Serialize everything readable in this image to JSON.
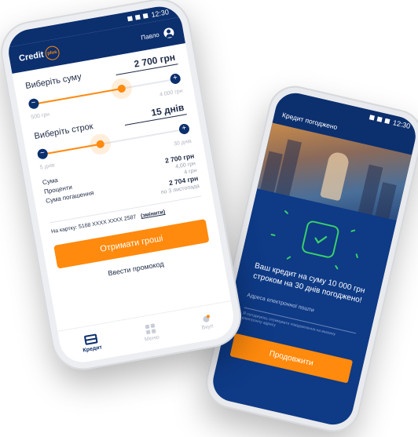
{
  "back_phone": {
    "status_time": "12:30",
    "header_title": "Кредит погоджено",
    "message": "Ваш кредит на суму 10 000 грн строком на 30 днів погоджено!",
    "email_label": "Адреса електронної пошти",
    "small_note": "Я погоджуюсь отримувати повідомлення на вказану електронну адресу",
    "continue_button": "Продовжити",
    "accent_color": "#ff8a0d",
    "bg_color": "#0e3a86",
    "success_color": "#3ad06a"
  },
  "front_phone": {
    "status_time": "12:30",
    "logo_text": "Credit",
    "logo_badge": "plus",
    "user_name": "Павло",
    "amount": {
      "label": "Виберіть суму",
      "value": "2 700 грн",
      "min": "500 грн",
      "max": "4 000 грн",
      "level": 0.63
    },
    "term": {
      "label": "Виберіть строк",
      "value": "15 днів",
      "min": "5 днів",
      "max": "30 днів",
      "level": 0.4
    },
    "summary": {
      "sum_label": "Сума",
      "sum_value": "2 700 грн",
      "interest_label": "Проценти",
      "interest_value": "4,00 грн",
      "interest_note": "4 грн",
      "repay_label": "Сума погашення",
      "repay_value": "2 704 грн",
      "repay_note": "по 3 листопада"
    },
    "card": {
      "text": "На картку: 5168 XXXX XXXX 2587",
      "change": "(змінити)"
    },
    "cta_button": "Отримати гроші",
    "promo_link": "Ввести промокод",
    "tabs": [
      {
        "label": "Кредит",
        "icon": "card-icon",
        "active": true
      },
      {
        "label": "Меню",
        "icon": "grid-icon",
        "active": false
      },
      {
        "label": "Вкуп",
        "icon": "dot-icon",
        "active": false
      }
    ],
    "brand_color": "#0c2f6e"
  }
}
